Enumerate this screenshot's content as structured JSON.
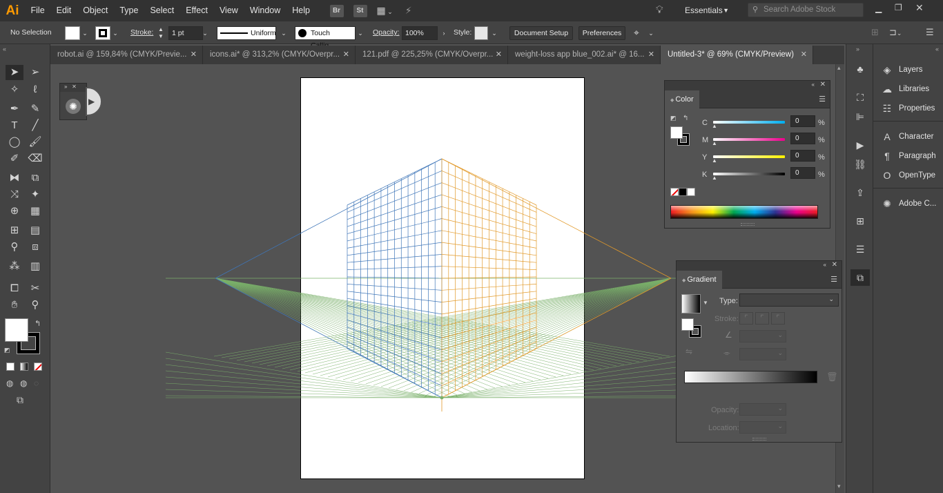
{
  "app": {
    "logo": "Ai"
  },
  "menu": [
    "File",
    "Edit",
    "Object",
    "Type",
    "Select",
    "Effect",
    "View",
    "Window",
    "Help"
  ],
  "menu_icons": {
    "bridge": "Br",
    "stock": "St"
  },
  "workspace": {
    "label": "Essentials"
  },
  "search": {
    "placeholder": "Search Adobe Stock"
  },
  "control": {
    "selection": "No Selection",
    "stroke_label": "Stroke:",
    "stroke_value": "1 pt",
    "profile": "Uniform",
    "brush": "Touch Callig...",
    "opacity_label": "Opacity:",
    "opacity_value": "100%",
    "style_label": "Style:",
    "document_setup": "Document Setup",
    "preferences": "Preferences"
  },
  "tabs": [
    {
      "label": "robot.ai @ 159,84% (CMYK/Previe..."
    },
    {
      "label": "icons.ai* @ 313,2% (CMYK/Overpr..."
    },
    {
      "label": "121.pdf @ 225,25% (CMYK/Overpr..."
    },
    {
      "label": "weight-loss app blue_002.ai* @ 16..."
    },
    {
      "label": "Untitled-3* @ 69% (CMYK/Preview)"
    }
  ],
  "color_panel": {
    "title": "Color",
    "channels": [
      {
        "label": "C",
        "value": "0",
        "unit": "%"
      },
      {
        "label": "M",
        "value": "0",
        "unit": "%"
      },
      {
        "label": "Y",
        "value": "0",
        "unit": "%"
      },
      {
        "label": "K",
        "value": "0",
        "unit": "%"
      }
    ]
  },
  "gradient_panel": {
    "title": "Gradient",
    "type_label": "Type:",
    "stroke_label": "Stroke:",
    "opacity_label": "Opacity:",
    "location_label": "Location:"
  },
  "dock": {
    "group1": [
      "Layers",
      "Libraries",
      "Properties"
    ],
    "group2": [
      "Character",
      "Paragraph",
      "OpenType"
    ],
    "group3": [
      "Adobe C..."
    ]
  },
  "colors": {
    "accent_orange": "#ff9a00",
    "left_grid": "#3f76b8",
    "right_grid": "#e29a2a",
    "ground_grid": "#7ab06a"
  }
}
